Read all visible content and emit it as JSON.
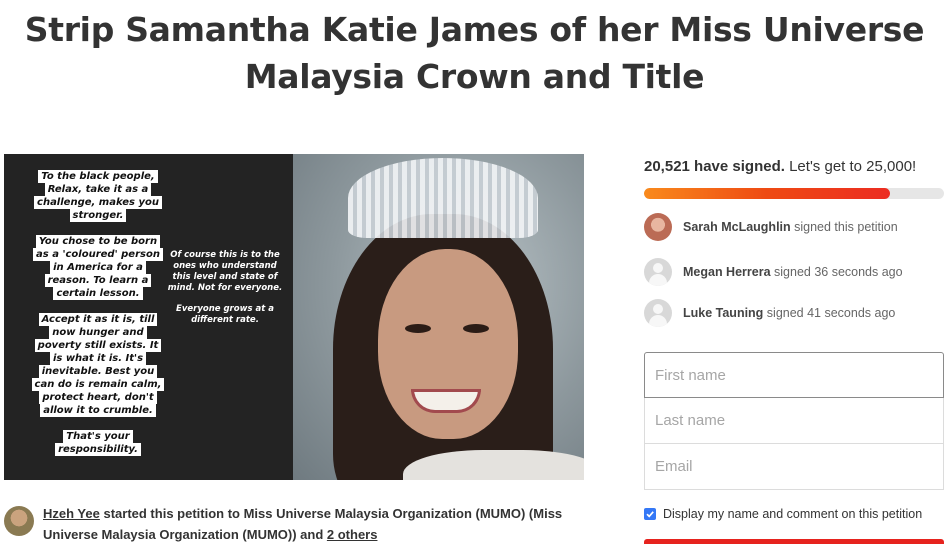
{
  "petition": {
    "title_line1": "Strip Samantha Katie James of her Miss Universe",
    "title_line2": "Malaysia Crown and Title"
  },
  "media": {
    "story_lines": [
      "To the black people,",
      "Relax, take it as a",
      "challenge, makes you",
      "stronger.",
      "You chose to be born",
      "as a 'coloured' person",
      "in America for a",
      "reason. To learn a",
      "certain lesson.",
      "Accept it as it is, till",
      "now hunger and",
      "poverty still exists. It",
      "is what it is. It's",
      "inevitable. Best you",
      "can do is remain calm,",
      "protect heart, don't",
      "allow it to crumble.",
      "That's your",
      "responsibility."
    ],
    "story_lines2": [
      "Of course this is to the ones who understand this level and state of mind. Not for everyone.",
      "Everyone grows at a different rate."
    ]
  },
  "starter": {
    "name": "Hzeh Yee",
    "text": " started this petition to Miss Universe Malaysia Organization (MUMO) (Miss Universe Malaysia Organization (MUMO)) and ",
    "others_link": "2 others"
  },
  "signatures": {
    "count_bold": "20,521 have signed.",
    "goal_text": " Let's get to 25,000!",
    "progress_fraction": 0.82
  },
  "recent_signers": [
    {
      "name": "Sarah McLaughlin",
      "action": " signed this petition",
      "avatar": "photo"
    },
    {
      "name": "Megan Herrera",
      "action": " signed 36 seconds ago",
      "avatar": "default-person-icon"
    },
    {
      "name": "Luke Tauning",
      "action": " signed 41 seconds ago",
      "avatar": "default-person-icon"
    }
  ],
  "form": {
    "first_name_placeholder": "First name",
    "last_name_placeholder": "Last name",
    "email_placeholder": "Email",
    "display_label": "Display my name and comment on this petition",
    "display_checked": true
  },
  "colors": {
    "progress_start": "#f98a1c",
    "progress_end": "#ec2c22",
    "checkbox": "#3478f6",
    "sign_button": "#e6231e"
  }
}
